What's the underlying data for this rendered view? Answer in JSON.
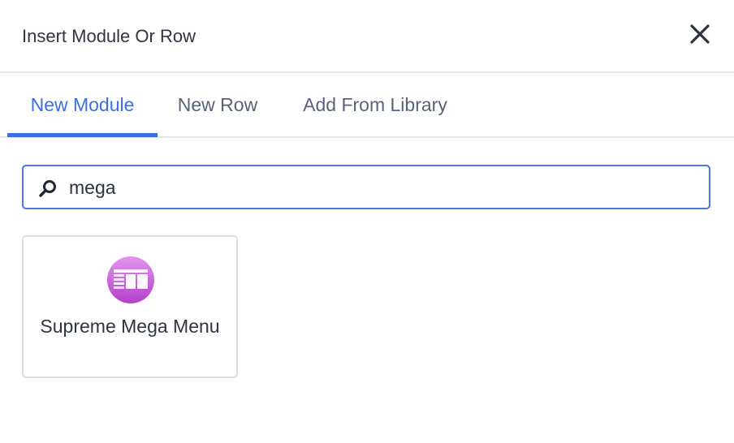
{
  "dialog": {
    "title": "Insert Module Or Row"
  },
  "tabs": [
    {
      "label": "New Module",
      "active": true
    },
    {
      "label": "New Row",
      "active": false
    },
    {
      "label": "Add From Library",
      "active": false
    }
  ],
  "search": {
    "value": "mega",
    "icon": "search-icon"
  },
  "results": [
    {
      "label": "Supreme Mega Menu",
      "icon": "mega-menu-icon"
    }
  ],
  "colors": {
    "accent": "#3c6ee6",
    "icon_gradient_top": "#e494f0",
    "icon_gradient_bottom": "#b33fc9"
  }
}
